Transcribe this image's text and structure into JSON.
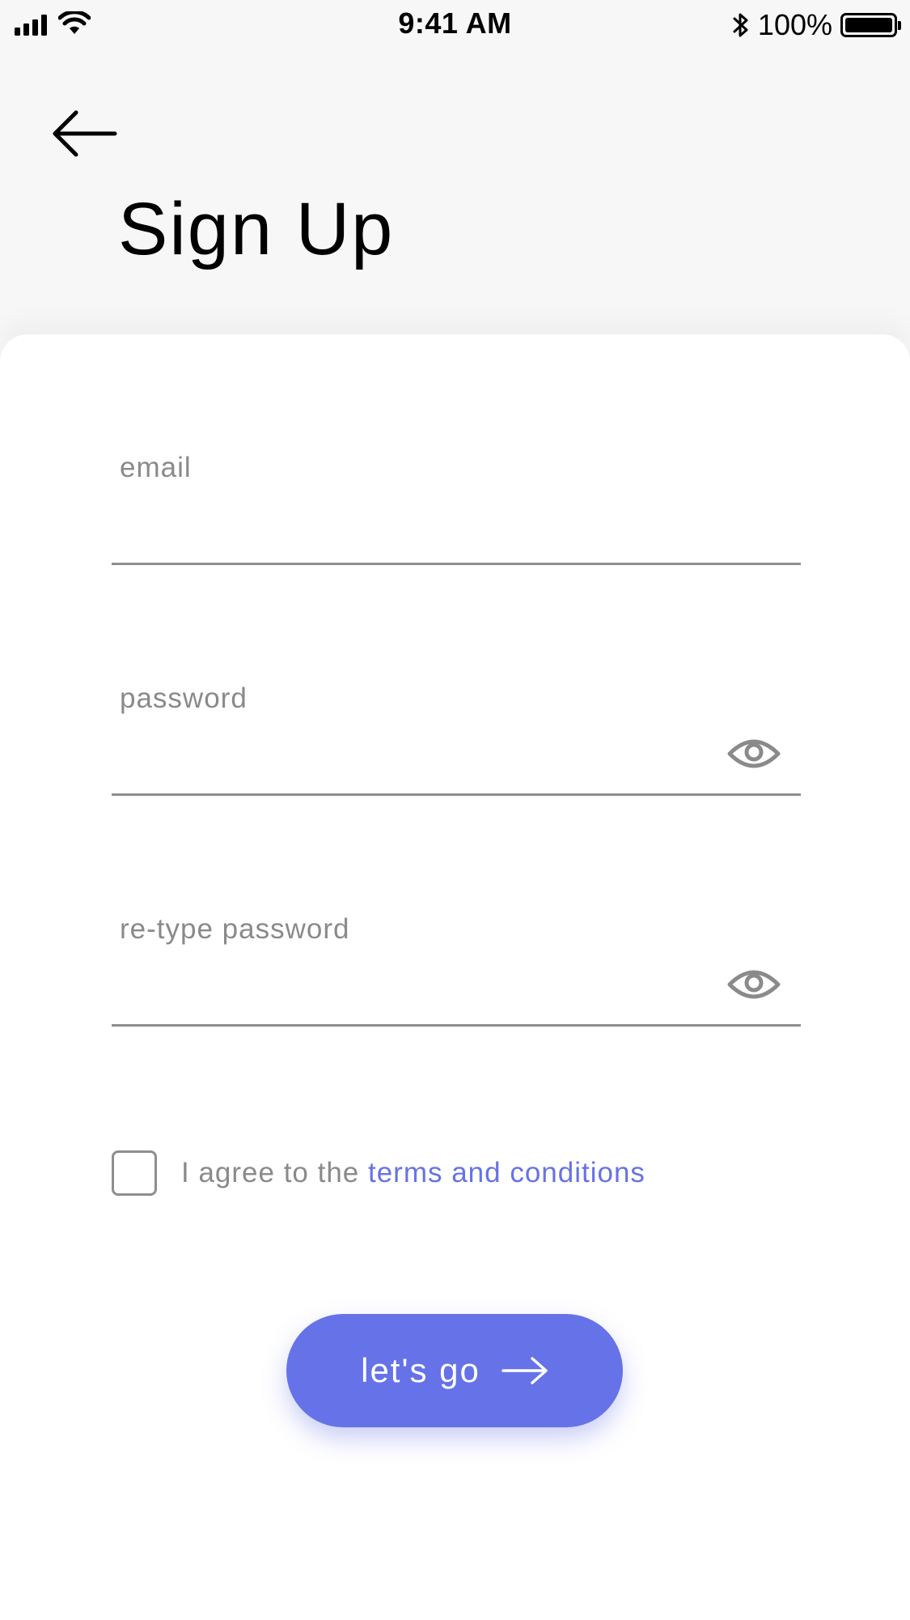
{
  "status_bar": {
    "time": "9:41 AM",
    "battery_percent": "100%",
    "battery_level": 1.0,
    "icons": [
      "cellular-signal-icon",
      "wifi-icon",
      "bluetooth-icon",
      "battery-icon"
    ]
  },
  "header": {
    "back_icon": "arrow-left-icon",
    "title": "Sign Up"
  },
  "form": {
    "email": {
      "label": "email",
      "value": ""
    },
    "password": {
      "label": "password",
      "value": "",
      "toggle_icon": "eye-icon"
    },
    "retype_password": {
      "label": "re-type password",
      "value": "",
      "toggle_icon": "eye-icon"
    },
    "agree": {
      "checked": false,
      "text": "I agree to the ",
      "link_text": "terms and conditions"
    }
  },
  "submit": {
    "label": "let's go",
    "icon": "arrow-right-icon"
  },
  "colors": {
    "accent": "#6672e8",
    "link": "#6772e5",
    "muted_text": "#8a8a8a",
    "background": "#f7f7f7",
    "card": "#ffffff"
  }
}
